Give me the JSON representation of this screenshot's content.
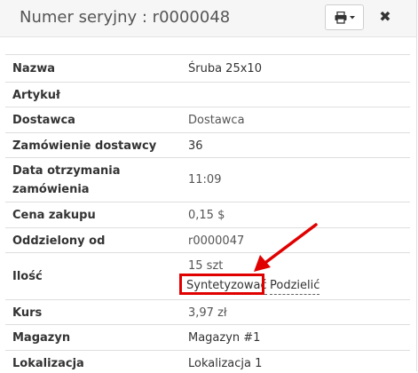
{
  "modal": {
    "title": "Numer seryjny : r0000048",
    "print_icon": "printer-icon",
    "dropdown_icon": "caret-down-icon",
    "close_label": "✖"
  },
  "rows": [
    {
      "label": "Nazwa",
      "value": "Śruba 25x10"
    },
    {
      "label": "Artykuł",
      "value": ""
    },
    {
      "label": "Dostawca",
      "value": "Dostawca"
    },
    {
      "label": "Zamówienie dostawcy",
      "value": "36"
    },
    {
      "label": "Data otrzymania zamówienia",
      "value": "11:09"
    },
    {
      "label": "Cena zakupu",
      "value": "0,15 $"
    },
    {
      "label": "Oddzielony od",
      "value": "r0000047"
    },
    {
      "label": "Ilość",
      "value": "15 szt"
    },
    {
      "label": "Kurs",
      "value": "3,97 zł"
    },
    {
      "label": "Magazyn",
      "value": "Magazyn #1"
    },
    {
      "label": "Lokalizacja",
      "value": "Lokalizacja 1"
    }
  ],
  "quantity_actions": {
    "synthesize_label": "Syntetyzować",
    "split_label": "Podzielić"
  },
  "annotation": {
    "highlight_color": "#e00000"
  }
}
